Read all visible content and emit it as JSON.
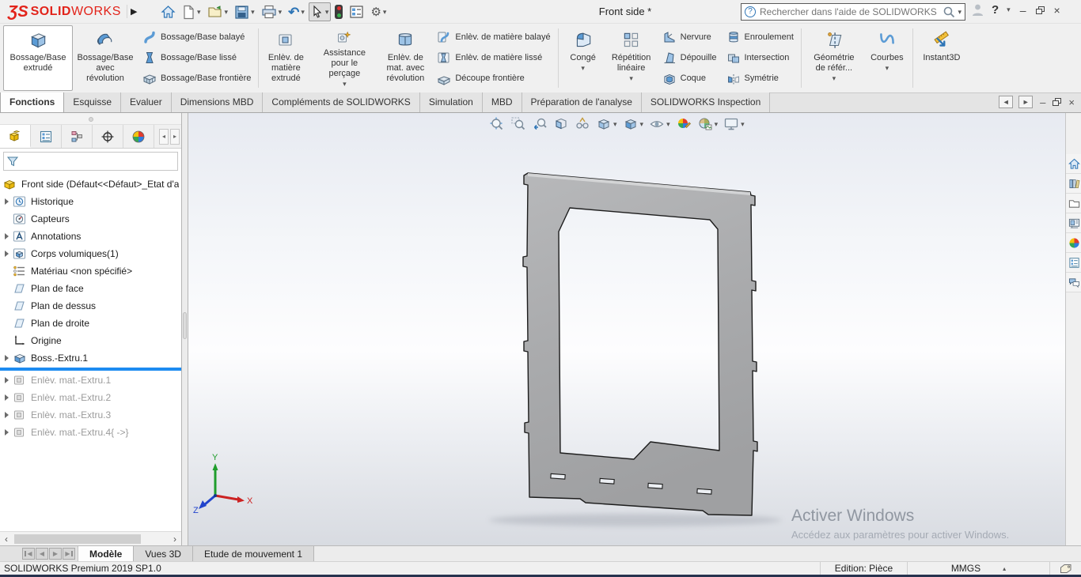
{
  "brand": {
    "logo_ds": "ƷS",
    "logo_solid": "SOLID",
    "logo_works": "WORKS"
  },
  "titlebar": {
    "title": "Front side *",
    "search_placeholder": "Rechercher dans l'aide de SOLIDWORKS"
  },
  "icons": {
    "dropdown": "▾",
    "flyout_right": "▶",
    "undo": "↶",
    "gear": "⚙",
    "help": "?",
    "search_help": "?",
    "minimize": "–",
    "close": "×",
    "pane_left": "◄",
    "pane_right": "►",
    "panel_scroll_left": "◂",
    "panel_scroll_right": "▸",
    "hscroll_left": "‹",
    "hscroll_right": "›",
    "tri_left": "◀",
    "tri_right": "▶",
    "units_caret": "▴"
  },
  "ribbon": {
    "extrude": "Bossage/Base extrudé",
    "revolve": "Bossage/Base avec révolution",
    "sweep": "Bossage/Base balayé",
    "loft": "Bossage/Base lissé",
    "boundary": "Bossage/Base frontière",
    "cut_extrude": "Enlèv. de matière extrudé",
    "hole_wizard": "Assistance pour le perçage",
    "cut_revolve": "Enlèv. de mat. avec révolution",
    "cut_sweep": "Enlèv. de matière balayé",
    "cut_loft": "Enlèv. de matière lissé",
    "boundary_cut": "Découpe frontière",
    "fillet": "Congé",
    "linear_pattern": "Répétition linéaire",
    "rib": "Nervure",
    "draft": "Dépouille",
    "shell": "Coque",
    "wrap": "Enroulement",
    "intersect": "Intersection",
    "mirror": "Symétrie",
    "ref_geometry": "Géométrie de référ...",
    "curves": "Courbes",
    "instant3d": "Instant3D"
  },
  "command_tabs": [
    "Fonctions",
    "Esquisse",
    "Evaluer",
    "Dimensions MBD",
    "Compléments de SOLIDWORKS",
    "Simulation",
    "MBD",
    "Préparation de l'analyse",
    "SOLIDWORKS Inspection"
  ],
  "feature_tree": {
    "root": "Front side  (Défaut<<Défaut>_Etat d'a",
    "items": [
      "Historique",
      "Capteurs",
      "Annotations",
      "Corps volumiques(1)",
      "Matériau <non spécifié>",
      "Plan de face",
      "Plan de dessus",
      "Plan de droite",
      "Origine",
      "Boss.-Extru.1",
      "Enlèv. mat.-Extru.1",
      "Enlèv. mat.-Extru.2",
      "Enlèv. mat.-Extru.3",
      "Enlèv. mat.-Extru.4{ ->}"
    ]
  },
  "viewport": {
    "triad": {
      "x": "X",
      "y": "Y",
      "z": "Z"
    },
    "watermark": {
      "title": "Activer Windows",
      "subtitle": "Accédez aux paramètres pour activer Windows."
    }
  },
  "bottom_tabs": [
    "Modèle",
    "Vues 3D",
    "Etude de mouvement 1"
  ],
  "statusbar": {
    "app_version": "SOLIDWORKS Premium 2019 SP1.0",
    "edition": "Edition: Pièce",
    "units": "MMGS"
  },
  "colors": {
    "brand_red": "#e2231a",
    "rollback_blue": "#1d8bf1",
    "accent_blue": "#5b9bd5"
  }
}
